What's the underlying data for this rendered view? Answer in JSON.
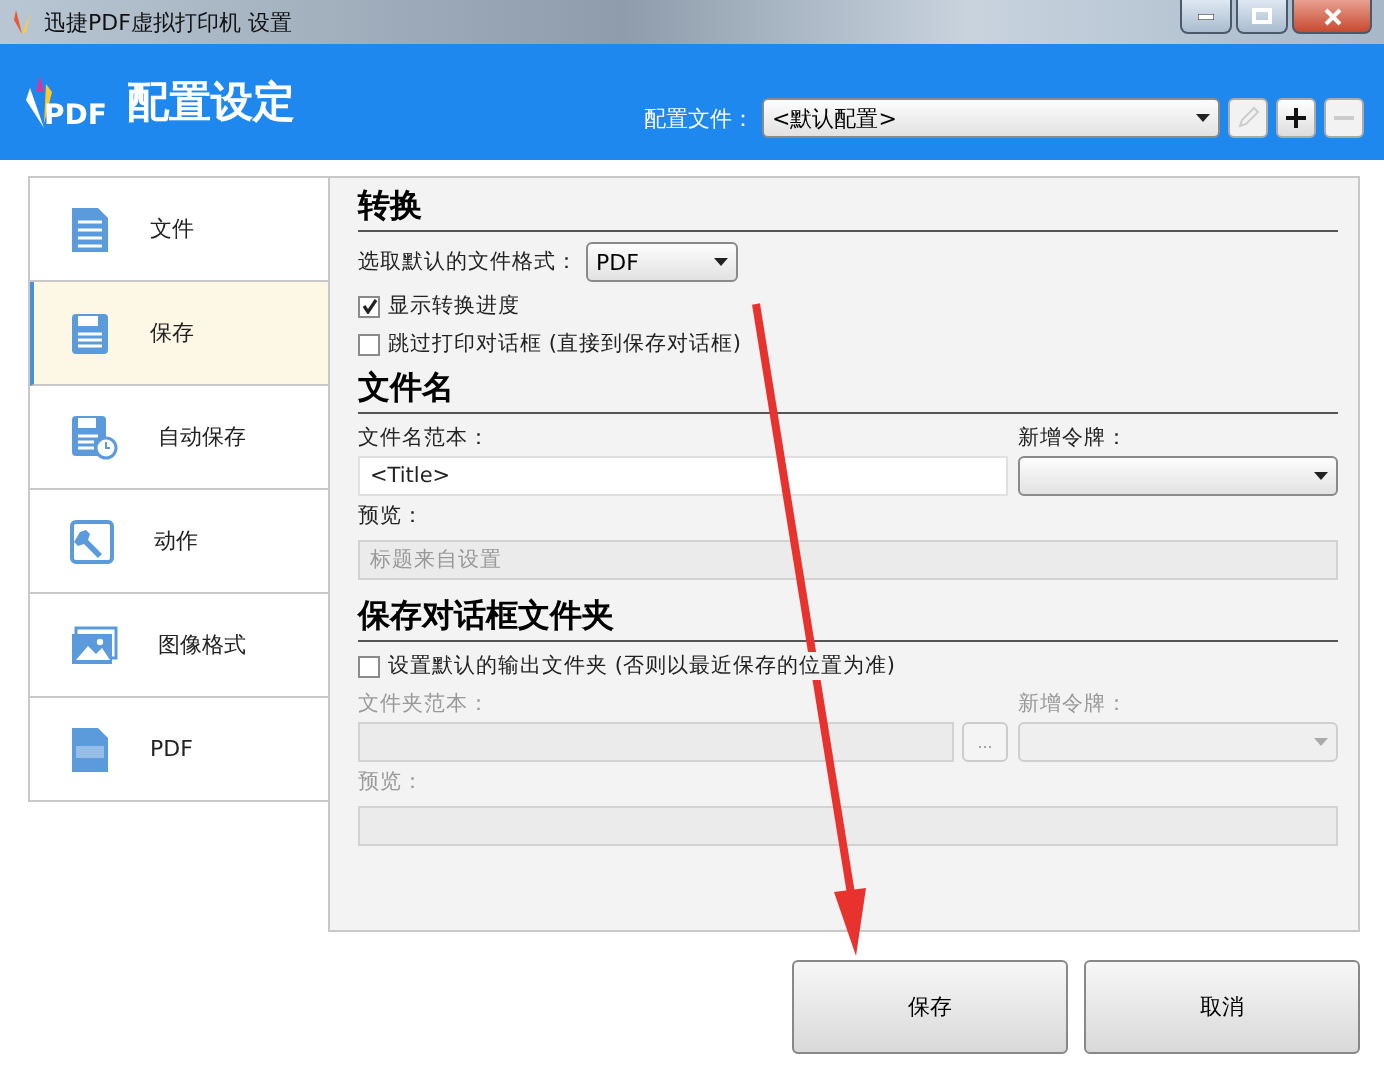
{
  "window": {
    "title": "迅捷PDF虚拟打印机 设置"
  },
  "header": {
    "logo": "PDF",
    "title": "配置设定",
    "profile_label": "配置文件：",
    "profile_value": "<默认配置>"
  },
  "sidebar": {
    "items": [
      {
        "label": "文件",
        "kind": "document",
        "selected": false
      },
      {
        "label": "保存",
        "kind": "save",
        "selected": true
      },
      {
        "label": "自动保存",
        "kind": "autosave",
        "selected": false
      },
      {
        "label": "动作",
        "kind": "action",
        "selected": false
      },
      {
        "label": "图像格式",
        "kind": "image",
        "selected": false
      },
      {
        "label": "PDF",
        "kind": "pdf",
        "selected": false
      }
    ]
  },
  "convert": {
    "heading": "转换",
    "format_label": "选取默认的文件格式：",
    "format_value": "PDF",
    "options": [
      {
        "label": "显示转换进度",
        "checked": true
      },
      {
        "label": "跳过打印对话框 (直接到保存对话框)",
        "checked": false
      }
    ]
  },
  "filename": {
    "heading": "文件名",
    "template_label": "文件名范本：",
    "template_value": "<Title>",
    "token_label": "新增令牌：",
    "preview_label": "预览：",
    "preview_value": "标题来自设置"
  },
  "folder": {
    "heading": "保存对话框文件夹",
    "option": {
      "label": "设置默认的输出文件夹 (否则以最近保存的位置为准)",
      "checked": false
    },
    "template_label": "文件夹范本：",
    "browse": "...",
    "token_label": "新增令牌：",
    "preview_label": "预览："
  },
  "buttons": [
    "保存",
    "取消"
  ]
}
